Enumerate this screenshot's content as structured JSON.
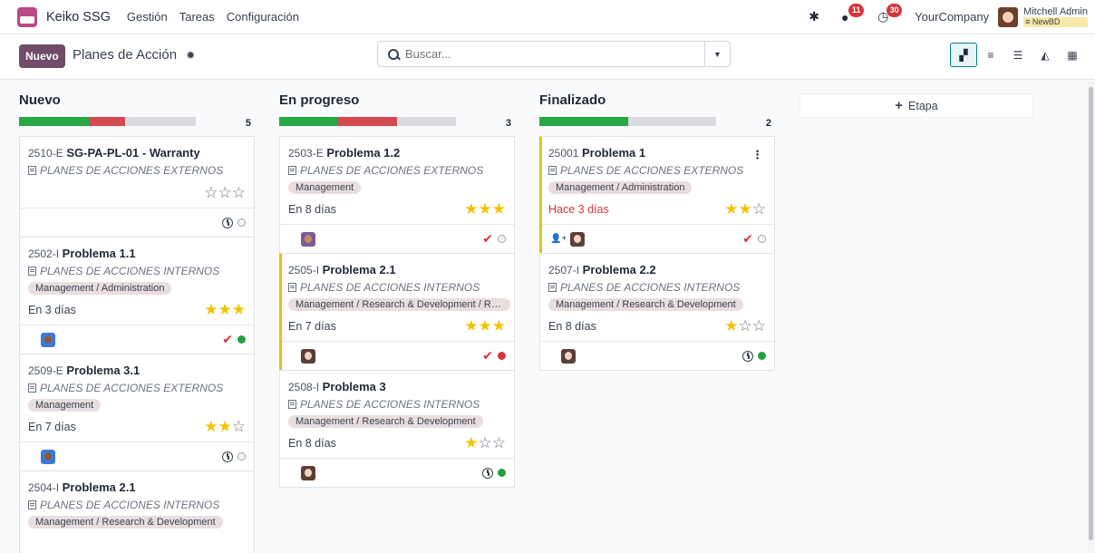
{
  "navbar": {
    "brand": "Keiko SSG",
    "menu": [
      "Gestión",
      "Tareas",
      "Configuración"
    ],
    "messages_badge": "11",
    "activities_badge": "30",
    "company": "YourCompany",
    "user_name": "Mitchell Admin",
    "user_db": "≡ NewBD"
  },
  "control": {
    "new_label": "Nuevo",
    "title": "Planes de Acción",
    "search_placeholder": "Buscar..."
  },
  "add_stage_label": "Etapa",
  "columns": [
    {
      "title": "Nuevo",
      "count": "5",
      "progress": {
        "green": 0.4,
        "red": 0.2
      },
      "cards": [
        {
          "ref": "2510-E",
          "title": "SG-PA-PL-01 - Warranty",
          "project": "PLANES DE ACCIONES EXTERNOS",
          "tag": "",
          "deadline": "",
          "stars": 0,
          "late": false
        },
        {
          "ref": "2502-I",
          "title": "Problema 1.1",
          "project": "PLANES DE ACCIONES INTERNOS",
          "tag": "Management / Administration",
          "deadline": "En 3 días",
          "stars": 3,
          "late": false
        },
        {
          "ref": "2509-E",
          "title": "Problema 3.1",
          "project": "PLANES DE ACCIONES EXTERNOS",
          "tag": "Management",
          "deadline": "En 7 días",
          "stars": 2,
          "late": false
        },
        {
          "ref": "2504-I",
          "title": "Problema 2.1",
          "project": "PLANES DE ACCIONES INTERNOS",
          "tag": "Management / Research & Development",
          "deadline": "",
          "stars": 0,
          "late": false
        }
      ]
    },
    {
      "title": "En progreso",
      "count": "3",
      "progress": {
        "green": 0.333,
        "red": 0.333
      },
      "cards": [
        {
          "ref": "2503-E",
          "title": "Problema 1.2",
          "project": "PLANES DE ACCIONES EXTERNOS",
          "tag": "Management",
          "deadline": "En 8 días",
          "stars": 3,
          "late": false
        },
        {
          "ref": "2505-I",
          "title": "Problema 2.1",
          "project": "PLANES DE ACCIONES INTERNOS",
          "tag": "Management / Research & Development / R&...",
          "deadline": "En 7 días",
          "stars": 3,
          "late": false
        },
        {
          "ref": "2508-I",
          "title": "Problema 3",
          "project": "PLANES DE ACCIONES INTERNOS",
          "tag": "Management / Research & Development",
          "deadline": "En 8 días",
          "stars": 1,
          "late": false
        }
      ]
    },
    {
      "title": "Finalizado",
      "count": "2",
      "progress": {
        "green": 0.5,
        "red": 0
      },
      "cards": [
        {
          "ref": "25001",
          "title": "Problema 1",
          "project": "PLANES DE ACCIONES EXTERNOS",
          "tag": "Management / Administration",
          "deadline": "Hace 3 días",
          "stars": 2,
          "late": true
        },
        {
          "ref": "2507-I",
          "title": "Problema 2.2",
          "project": "PLANES DE ACCIONES INTERNOS",
          "tag": "Management / Research & Development",
          "deadline": "En 8 días",
          "stars": 1,
          "late": false
        }
      ]
    }
  ]
}
